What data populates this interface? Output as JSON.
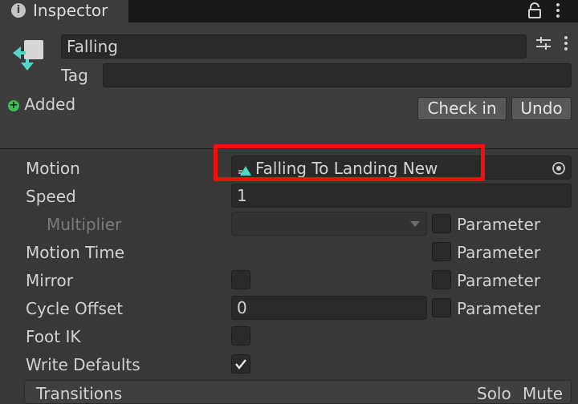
{
  "tab": {
    "title": "Inspector",
    "icon": "info-icon"
  },
  "object": {
    "name": "Falling",
    "tag_label": "Tag",
    "tag_value": "",
    "status": "Added",
    "check_in": "Check in",
    "undo": "Undo"
  },
  "properties": {
    "motion": {
      "label": "Motion",
      "value": "Falling To Landing New"
    },
    "speed": {
      "label": "Speed",
      "value": "1"
    },
    "multiplier": {
      "label": "Multiplier",
      "value": "",
      "param": "Parameter"
    },
    "motion_time": {
      "label": "Motion Time",
      "param": "Parameter"
    },
    "mirror": {
      "label": "Mirror",
      "param": "Parameter",
      "checked": false
    },
    "cycle_offset": {
      "label": "Cycle Offset",
      "value": "0",
      "param": "Parameter"
    },
    "foot_ik": {
      "label": "Foot IK",
      "checked": false
    },
    "write_defaults": {
      "label": "Write Defaults",
      "checked": true
    }
  },
  "transitions": {
    "label": "Transitions",
    "solo": "Solo",
    "mute": "Mute"
  },
  "colors": {
    "highlight": "#f40d0d",
    "accent_teal": "#4fd8c8",
    "added_green": "#3bbf55"
  }
}
